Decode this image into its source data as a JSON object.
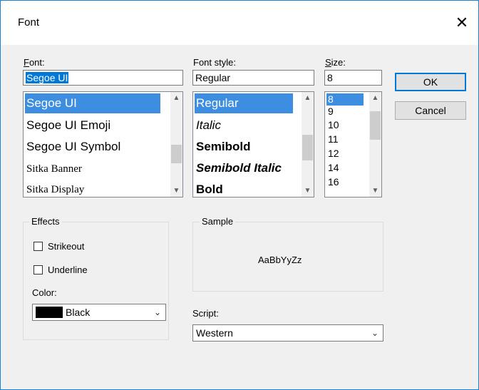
{
  "window": {
    "title": "Font",
    "close_glyph": "✕"
  },
  "font": {
    "label": "Font:",
    "value": "Segoe UI",
    "items": [
      "Segoe UI",
      "Segoe UI Emoji",
      "Segoe UI Symbol",
      "Sitka Banner",
      "Sitka Display"
    ],
    "selected": "Segoe UI"
  },
  "style": {
    "label": "Font style:",
    "value": "Regular",
    "items": [
      "Regular",
      "Italic",
      "Semibold",
      "Semibold Italic",
      "Bold"
    ],
    "selected": "Regular"
  },
  "size": {
    "label": "Size:",
    "value": "8",
    "items": [
      "8",
      "9",
      "10",
      "11",
      "12",
      "14",
      "16"
    ],
    "selected": "8"
  },
  "buttons": {
    "ok": "OK",
    "cancel": "Cancel"
  },
  "effects": {
    "title": "Effects",
    "strikeout": "Strikeout",
    "underline": "Underline",
    "color_label": "Color:",
    "color_value": "Black",
    "color_hex": "#000000"
  },
  "sample": {
    "title": "Sample",
    "text": "AaBbYyZz"
  },
  "script": {
    "label": "Script:",
    "value": "Western"
  },
  "icons": {
    "scroll_up": "chevron-up-icon",
    "scroll_down": "chevron-down-icon",
    "dropdown": "chevron-down-icon",
    "close": "close-icon"
  }
}
